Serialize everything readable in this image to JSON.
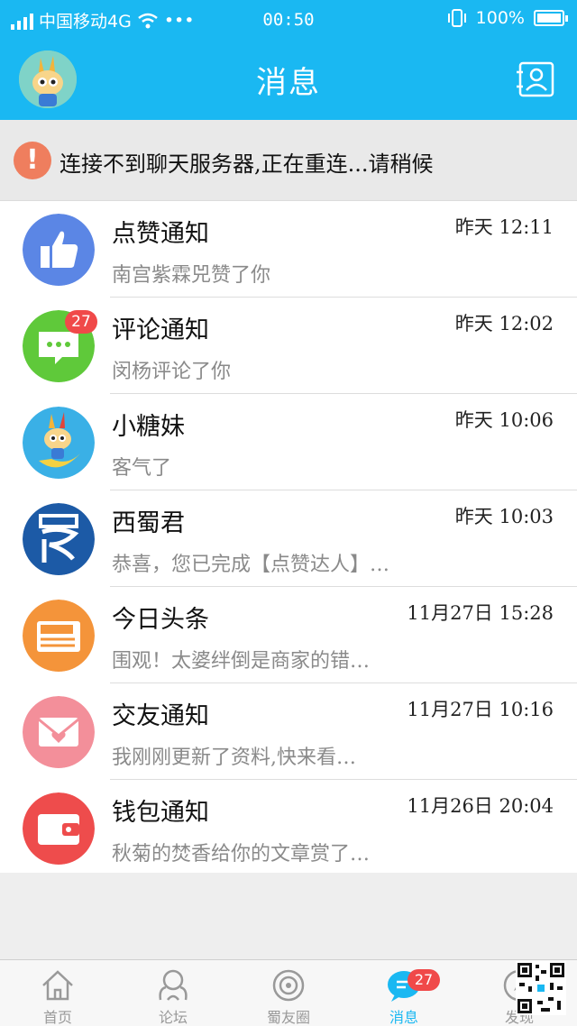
{
  "status_bar": {
    "carrier": "中国移动4G",
    "more": "•••",
    "time": "00:50",
    "battery": "100%"
  },
  "header": {
    "title": "消息"
  },
  "alert": {
    "text": "连接不到聊天服务器,正在重连...请稍候"
  },
  "messages": [
    {
      "name": "点赞通知",
      "time": "昨天 12:11",
      "preview": "南宫紫霖兕赞了你",
      "icon": "thumbs-up-icon",
      "color": "#5b86e5"
    },
    {
      "name": "评论通知",
      "time": "昨天 12:02",
      "preview": "闵杨评论了你",
      "icon": "chat-bubble-icon",
      "color": "#5fc93a",
      "badge": "27"
    },
    {
      "name": "小糖妹",
      "time": "昨天 10:06",
      "preview": "客气了",
      "icon": "rabbit-mascot-avatar",
      "color": "#3ab0e6"
    },
    {
      "name": "西蜀君",
      "time": "昨天 10:03",
      "preview": "恭喜，您已完成【点赞达人】…",
      "icon": "shu-logo-avatar",
      "color": "#1c5aa6"
    },
    {
      "name": "今日头条",
      "time": "11月27日 15:28",
      "preview": "围观！太婆绊倒是商家的错…",
      "icon": "newspaper-icon",
      "color": "#f4943a"
    },
    {
      "name": "交友通知",
      "time": "11月27日 10:16",
      "preview": "我刚刚更新了资料,快来看…",
      "icon": "heart-envelope-icon",
      "color": "#f38f9a"
    },
    {
      "name": "钱包通知",
      "time": "11月26日 20:04",
      "preview": "秋菊的焚香给你的文章赏了…",
      "icon": "wallet-icon",
      "color": "#ee4c4c"
    }
  ],
  "tabs": [
    {
      "label": "首页",
      "icon": "home-icon"
    },
    {
      "label": "论坛",
      "icon": "forum-icon"
    },
    {
      "label": "蜀友圈",
      "icon": "friends-circle-icon"
    },
    {
      "label": "消息",
      "icon": "message-icon",
      "badge": "27",
      "active": true
    },
    {
      "label": "发现",
      "icon": "discover-icon"
    }
  ],
  "colors": {
    "primary": "#1ab8f2",
    "badge": "#f04949",
    "alert": "#ef7e5e"
  }
}
